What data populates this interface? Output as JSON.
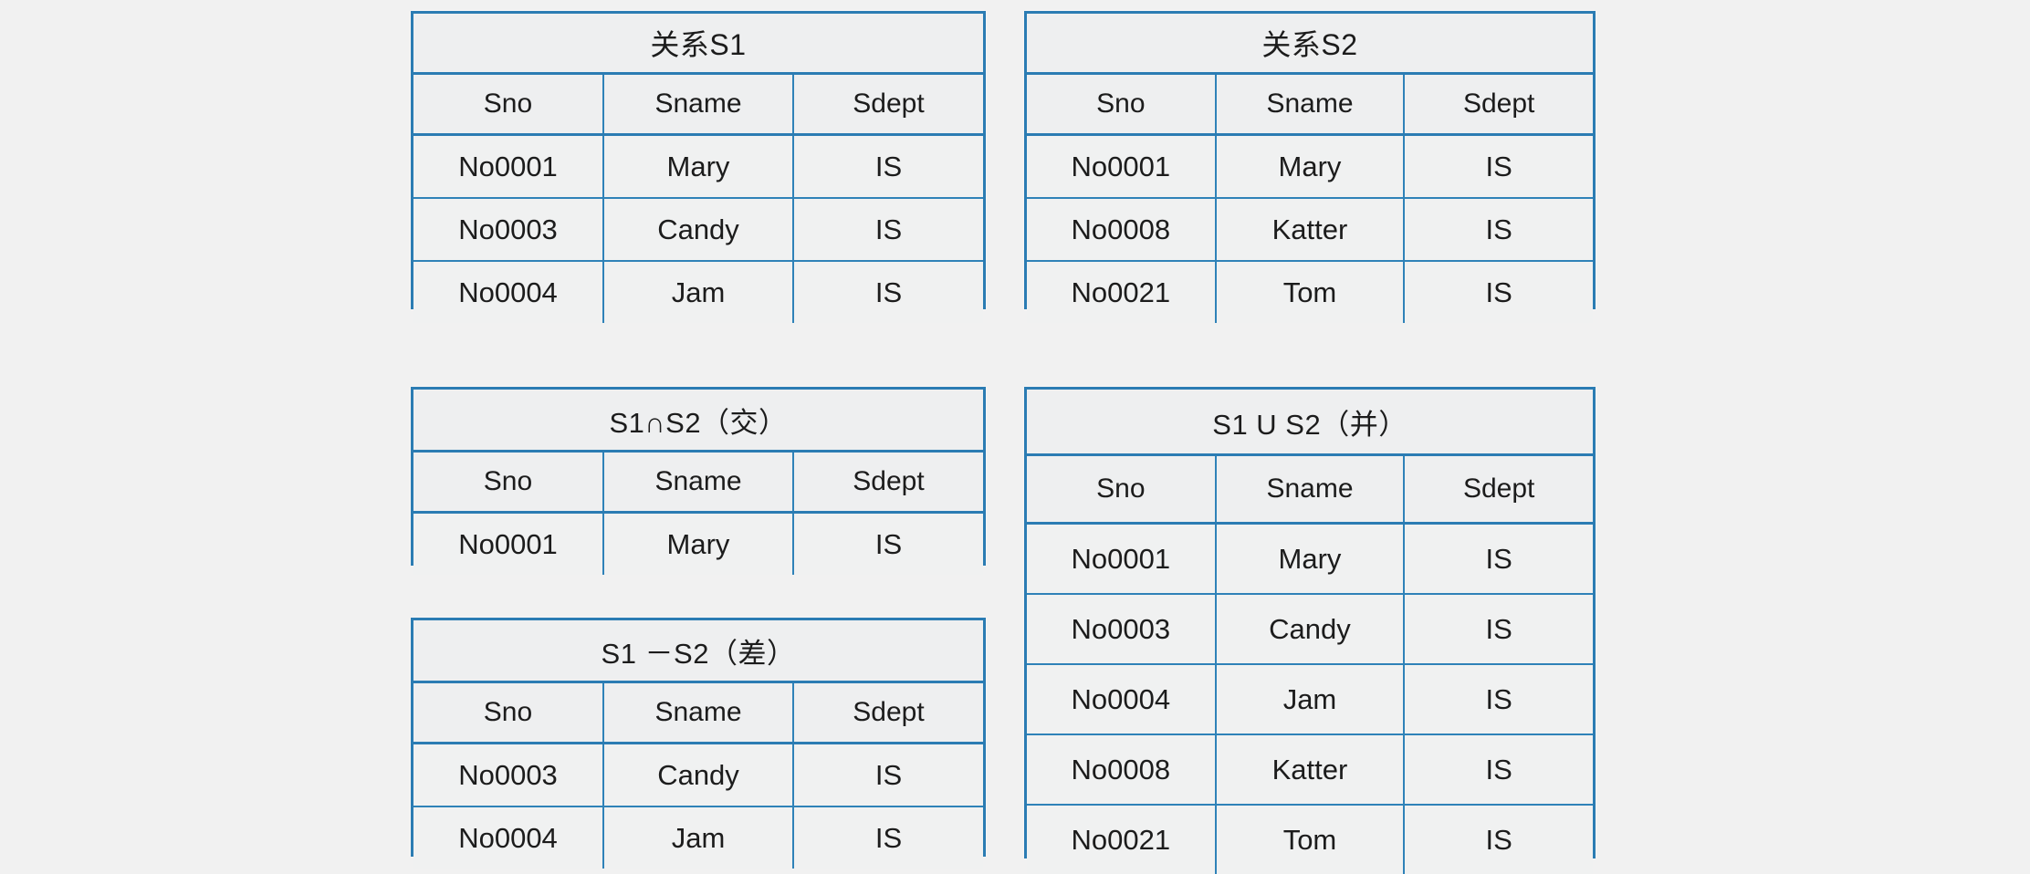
{
  "page": {
    "background_color": "#f1f1f1",
    "border_color": "#2b7cb3",
    "cell_background": "#eff0f0",
    "text_color": "#1c1c1c"
  },
  "tables": {
    "s1": {
      "title": "关系S1",
      "columns": [
        "Sno",
        "Sname",
        "Sdept"
      ],
      "rows": [
        [
          "No0001",
          "Mary",
          "IS"
        ],
        [
          "No0003",
          "Candy",
          "IS"
        ],
        [
          "No0004",
          "Jam",
          "IS"
        ]
      ]
    },
    "s2": {
      "title": "关系S2",
      "columns": [
        "Sno",
        "Sname",
        "Sdept"
      ],
      "rows": [
        [
          "No0001",
          "Mary",
          "IS"
        ],
        [
          "No0008",
          "Katter",
          "IS"
        ],
        [
          "No0021",
          "Tom",
          "IS"
        ]
      ]
    },
    "intersect": {
      "title": "S1∩S2（交）",
      "columns": [
        "Sno",
        "Sname",
        "Sdept"
      ],
      "rows": [
        [
          "No0001",
          "Mary",
          "IS"
        ]
      ]
    },
    "difference": {
      "title": "S1 －S2（差）",
      "columns": [
        "Sno",
        "Sname",
        "Sdept"
      ],
      "rows": [
        [
          "No0003",
          "Candy",
          "IS"
        ],
        [
          "No0004",
          "Jam",
          "IS"
        ]
      ]
    },
    "union": {
      "title": "S1 U S2（并）",
      "columns": [
        "Sno",
        "Sname",
        "Sdept"
      ],
      "rows": [
        [
          "No0001",
          "Mary",
          "IS"
        ],
        [
          "No0003",
          "Candy",
          "IS"
        ],
        [
          "No0004",
          "Jam",
          "IS"
        ],
        [
          "No0008",
          "Katter",
          "IS"
        ],
        [
          "No0021",
          "Tom",
          "IS"
        ]
      ]
    }
  }
}
